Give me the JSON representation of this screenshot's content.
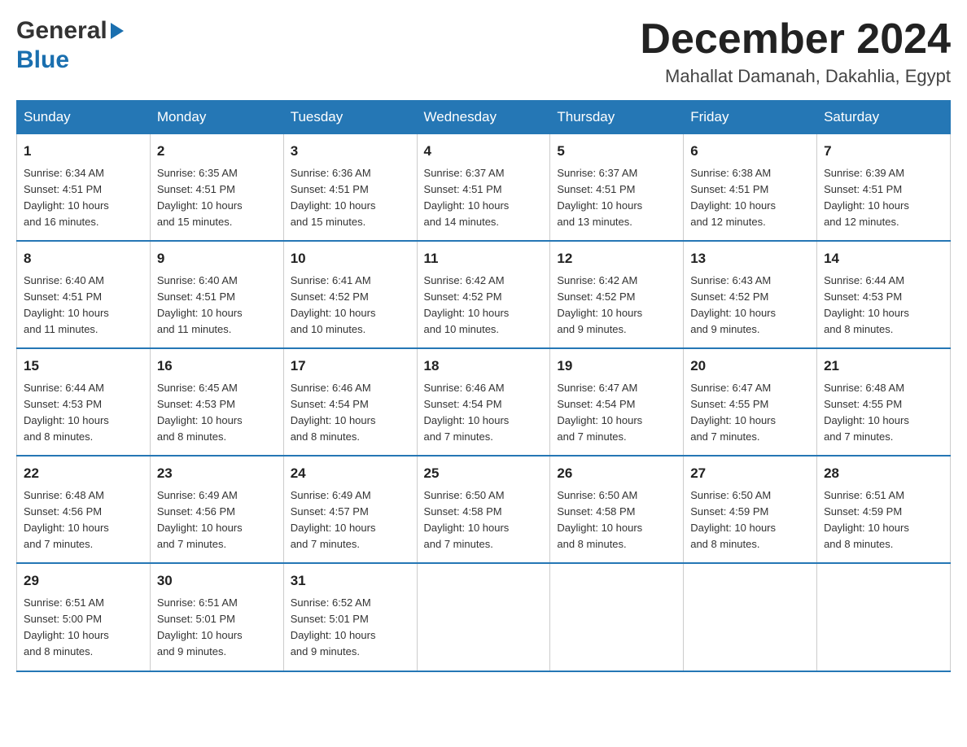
{
  "header": {
    "logo_general": "General",
    "logo_blue": "Blue",
    "month_title": "December 2024",
    "location": "Mahallat Damanah, Dakahlia, Egypt"
  },
  "days_of_week": [
    "Sunday",
    "Monday",
    "Tuesday",
    "Wednesday",
    "Thursday",
    "Friday",
    "Saturday"
  ],
  "weeks": [
    [
      {
        "day": "1",
        "sunrise": "6:34 AM",
        "sunset": "4:51 PM",
        "daylight": "10 hours and 16 minutes."
      },
      {
        "day": "2",
        "sunrise": "6:35 AM",
        "sunset": "4:51 PM",
        "daylight": "10 hours and 15 minutes."
      },
      {
        "day": "3",
        "sunrise": "6:36 AM",
        "sunset": "4:51 PM",
        "daylight": "10 hours and 15 minutes."
      },
      {
        "day": "4",
        "sunrise": "6:37 AM",
        "sunset": "4:51 PM",
        "daylight": "10 hours and 14 minutes."
      },
      {
        "day": "5",
        "sunrise": "6:37 AM",
        "sunset": "4:51 PM",
        "daylight": "10 hours and 13 minutes."
      },
      {
        "day": "6",
        "sunrise": "6:38 AM",
        "sunset": "4:51 PM",
        "daylight": "10 hours and 12 minutes."
      },
      {
        "day": "7",
        "sunrise": "6:39 AM",
        "sunset": "4:51 PM",
        "daylight": "10 hours and 12 minutes."
      }
    ],
    [
      {
        "day": "8",
        "sunrise": "6:40 AM",
        "sunset": "4:51 PM",
        "daylight": "10 hours and 11 minutes."
      },
      {
        "day": "9",
        "sunrise": "6:40 AM",
        "sunset": "4:51 PM",
        "daylight": "10 hours and 11 minutes."
      },
      {
        "day": "10",
        "sunrise": "6:41 AM",
        "sunset": "4:52 PM",
        "daylight": "10 hours and 10 minutes."
      },
      {
        "day": "11",
        "sunrise": "6:42 AM",
        "sunset": "4:52 PM",
        "daylight": "10 hours and 10 minutes."
      },
      {
        "day": "12",
        "sunrise": "6:42 AM",
        "sunset": "4:52 PM",
        "daylight": "10 hours and 9 minutes."
      },
      {
        "day": "13",
        "sunrise": "6:43 AM",
        "sunset": "4:52 PM",
        "daylight": "10 hours and 9 minutes."
      },
      {
        "day": "14",
        "sunrise": "6:44 AM",
        "sunset": "4:53 PM",
        "daylight": "10 hours and 8 minutes."
      }
    ],
    [
      {
        "day": "15",
        "sunrise": "6:44 AM",
        "sunset": "4:53 PM",
        "daylight": "10 hours and 8 minutes."
      },
      {
        "day": "16",
        "sunrise": "6:45 AM",
        "sunset": "4:53 PM",
        "daylight": "10 hours and 8 minutes."
      },
      {
        "day": "17",
        "sunrise": "6:46 AM",
        "sunset": "4:54 PM",
        "daylight": "10 hours and 8 minutes."
      },
      {
        "day": "18",
        "sunrise": "6:46 AM",
        "sunset": "4:54 PM",
        "daylight": "10 hours and 7 minutes."
      },
      {
        "day": "19",
        "sunrise": "6:47 AM",
        "sunset": "4:54 PM",
        "daylight": "10 hours and 7 minutes."
      },
      {
        "day": "20",
        "sunrise": "6:47 AM",
        "sunset": "4:55 PM",
        "daylight": "10 hours and 7 minutes."
      },
      {
        "day": "21",
        "sunrise": "6:48 AM",
        "sunset": "4:55 PM",
        "daylight": "10 hours and 7 minutes."
      }
    ],
    [
      {
        "day": "22",
        "sunrise": "6:48 AM",
        "sunset": "4:56 PM",
        "daylight": "10 hours and 7 minutes."
      },
      {
        "day": "23",
        "sunrise": "6:49 AM",
        "sunset": "4:56 PM",
        "daylight": "10 hours and 7 minutes."
      },
      {
        "day": "24",
        "sunrise": "6:49 AM",
        "sunset": "4:57 PM",
        "daylight": "10 hours and 7 minutes."
      },
      {
        "day": "25",
        "sunrise": "6:50 AM",
        "sunset": "4:58 PM",
        "daylight": "10 hours and 7 minutes."
      },
      {
        "day": "26",
        "sunrise": "6:50 AM",
        "sunset": "4:58 PM",
        "daylight": "10 hours and 8 minutes."
      },
      {
        "day": "27",
        "sunrise": "6:50 AM",
        "sunset": "4:59 PM",
        "daylight": "10 hours and 8 minutes."
      },
      {
        "day": "28",
        "sunrise": "6:51 AM",
        "sunset": "4:59 PM",
        "daylight": "10 hours and 8 minutes."
      }
    ],
    [
      {
        "day": "29",
        "sunrise": "6:51 AM",
        "sunset": "5:00 PM",
        "daylight": "10 hours and 8 minutes."
      },
      {
        "day": "30",
        "sunrise": "6:51 AM",
        "sunset": "5:01 PM",
        "daylight": "10 hours and 9 minutes."
      },
      {
        "day": "31",
        "sunrise": "6:52 AM",
        "sunset": "5:01 PM",
        "daylight": "10 hours and 9 minutes."
      },
      null,
      null,
      null,
      null
    ]
  ],
  "labels": {
    "sunrise": "Sunrise:",
    "sunset": "Sunset:",
    "daylight": "Daylight:"
  }
}
